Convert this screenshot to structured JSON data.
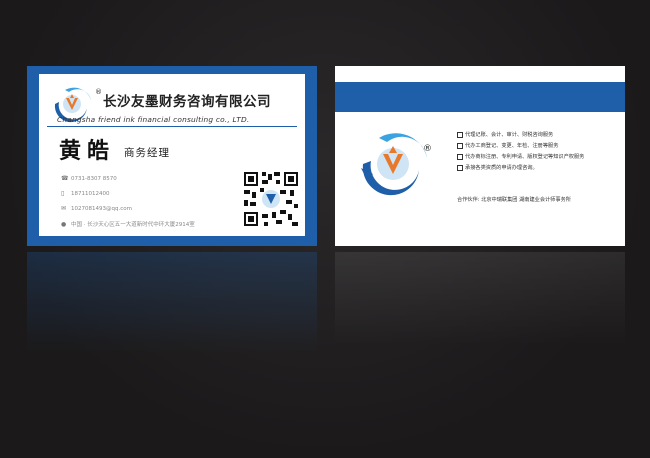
{
  "front": {
    "company_cn": "长沙友墨财务咨询有限公司",
    "company_en": "Changsha friend ink financial consulting co., LTD.",
    "registered_mark": "®",
    "name": "黄皓",
    "title": "商务经理",
    "contacts": [
      {
        "icon": "telephone-icon",
        "glyph": "☎",
        "text": "0731-8307 8570"
      },
      {
        "icon": "mobile-phone-icon",
        "glyph": "▯",
        "text": "18711012400"
      },
      {
        "icon": "email-icon",
        "glyph": "✉",
        "text": "1027081493@qq.com"
      },
      {
        "icon": "location-pin-icon",
        "glyph": "●",
        "text": "中国 · 长沙天心区五一大道新时代中环大厦2914室"
      }
    ]
  },
  "back": {
    "registered_mark": "®",
    "services": [
      "代理记账、会计、审计、财税咨询服务",
      "代办工商登记、变更、年检、注册等服务",
      "代办商标注册、专利申请、版权登记等知识产权服务",
      "承接各类资质的申请办理咨询。"
    ],
    "partners": "合作伙伴: 北京中瑞联集团  湖南建业会计师事务所"
  },
  "colors": {
    "brand_blue": "#1f5ea8",
    "accent_orange": "#e8792b",
    "light_blue": "#3aa3e0"
  }
}
